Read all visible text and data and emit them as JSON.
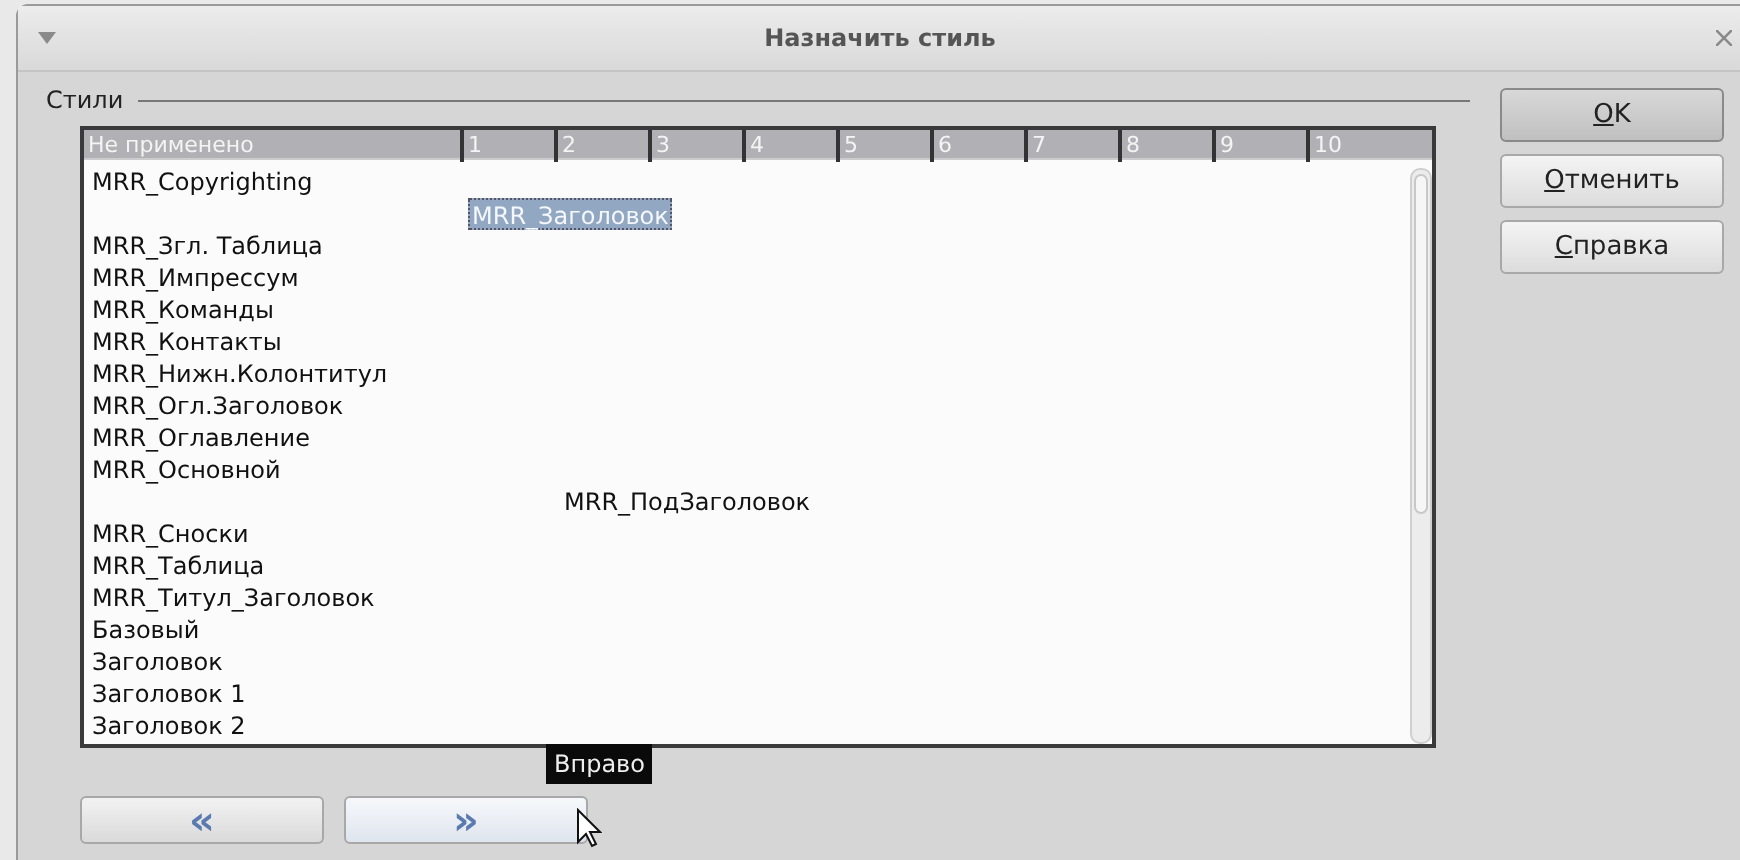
{
  "window": {
    "title": "Назначить стиль"
  },
  "group": {
    "label": "Стили"
  },
  "columns": [
    "Не применено",
    "1",
    "2",
    "3",
    "4",
    "5",
    "6",
    "7",
    "8",
    "9",
    "10"
  ],
  "rows": [
    {
      "text": "MRR_Copyrighting",
      "kind": "unapplied",
      "selected": false
    },
    {
      "text": "MRR_Заголовок",
      "kind": "first",
      "selected": true
    },
    {
      "text": "MRR_Згл. Таблица",
      "kind": "unapplied",
      "selected": false
    },
    {
      "text": "MRR_Импрессум",
      "kind": "unapplied",
      "selected": false
    },
    {
      "text": "MRR_Команды",
      "kind": "unapplied",
      "selected": false
    },
    {
      "text": "MRR_Контакты",
      "kind": "unapplied",
      "selected": false
    },
    {
      "text": "MRR_Нижн.Колонтитул",
      "kind": "unapplied",
      "selected": false
    },
    {
      "text": "MRR_Огл.Заголовок",
      "kind": "unapplied",
      "selected": false
    },
    {
      "text": "MRR_Оглавление",
      "kind": "unapplied",
      "selected": false
    },
    {
      "text": "MRR_Основной",
      "kind": "unapplied",
      "selected": false
    },
    {
      "text": "MRR_ПодЗаголовок",
      "kind": "second",
      "selected": false
    },
    {
      "text": "MRR_Сноски",
      "kind": "unapplied",
      "selected": false
    },
    {
      "text": "MRR_Таблица",
      "kind": "unapplied",
      "selected": false
    },
    {
      "text": "MRR_Титул_Заголовок",
      "kind": "unapplied",
      "selected": false
    },
    {
      "text": "Базовый",
      "kind": "unapplied",
      "selected": false
    },
    {
      "text": "Заголовок",
      "kind": "unapplied",
      "selected": false
    },
    {
      "text": "Заголовок 1",
      "kind": "unapplied",
      "selected": false
    },
    {
      "text": "Заголовок 2",
      "kind": "unapplied",
      "selected": false
    }
  ],
  "move_buttons": [
    {
      "label": "«",
      "hovered": false
    },
    {
      "label": "»",
      "hovered": true
    }
  ],
  "tooltip": "Вправо",
  "buttons": [
    {
      "label": "OK",
      "mnemonic": true,
      "default": true
    },
    {
      "label": "Отменить",
      "mnemonic": true,
      "default": false
    },
    {
      "label": "Справка",
      "mnemonic": true,
      "default": false
    }
  ]
}
